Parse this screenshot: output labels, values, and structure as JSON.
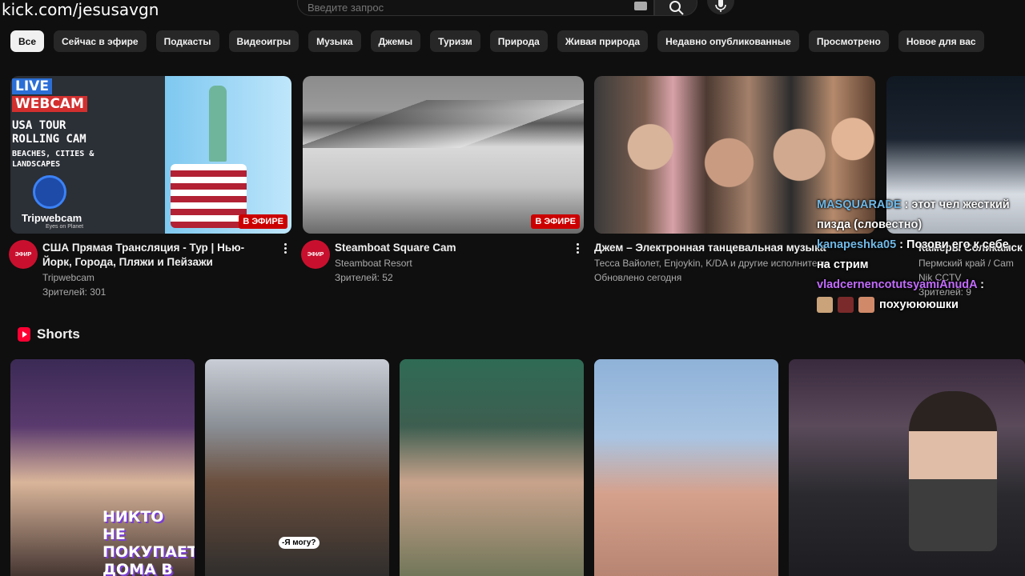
{
  "watermark": "kick.com/jesusavgn",
  "search": {
    "placeholder": "Введите запрос"
  },
  "chips": [
    "Все",
    "Сейчас в эфире",
    "Подкасты",
    "Видеоигры",
    "Музыка",
    "Джемы",
    "Туризм",
    "Природа",
    "Живая природа",
    "Недавно опубликованные",
    "Просмотрено",
    "Новое для вас"
  ],
  "videos": [
    {
      "thumb": {
        "top": "LIVE",
        "brand": "WEBCAM",
        "line1": "USA TOUR",
        "line2": "ROLLING CAM",
        "line3": "BEACHES, CITIES &",
        "line4": "LANDSCAPES",
        "logo": "Tripwebcam",
        "slogan": "Eyes on Planet"
      },
      "live": "В ЭФИРЕ",
      "avatar": "ЭФИР",
      "title": "США Прямая Трансляция - Тур | Нью-Йорк, Города, Пляжи и Пейзажи",
      "channel": "Tripwebcam",
      "views": "Зрителей: 301"
    },
    {
      "live": "В ЭФИРЕ",
      "avatar": "ЭФИР",
      "title": "Steamboat Square Cam",
      "channel": "Steamboat Resort",
      "views": "Зрителей: 52"
    },
    {
      "title": "Джем – Электронная танцевальная музыка",
      "channel": "Тесса Вайолет, Enjoykin, K/DA и другие исполнители",
      "views": "Обновлено сегодня"
    },
    {
      "title": "Камеры Соликамск (E",
      "channel": "Пермский край / Cam",
      "sub": "Nik CCTV",
      "views": "Зрителей: 9"
    }
  ],
  "shorts": {
    "title": "Shorts",
    "items": [
      {
        "cap": "НИКТО НЕ ПОКУПАЕТ ДОМА В США"
      },
      {
        "cap": "-Я могу?"
      },
      {
        "cap": ""
      },
      {
        "cap": ""
      },
      {
        "cap": ""
      }
    ]
  },
  "chat": [
    {
      "user": "MASQUARADE",
      "msg": "этот чел жесткий пизда (словестно)"
    },
    {
      "user": "kanapeshka05",
      "msg": "Позови его к себе на стрим"
    },
    {
      "user": "vladcernencotutsyamiAnudA",
      "msg": "похуюююшки"
    }
  ]
}
